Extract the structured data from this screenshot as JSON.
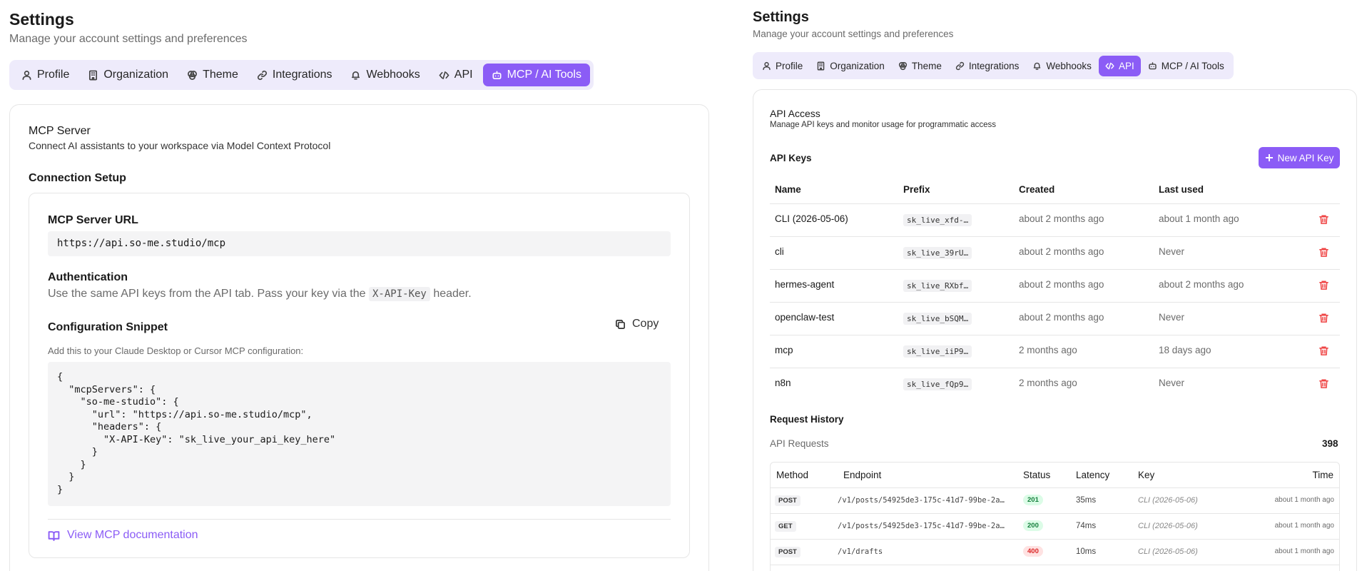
{
  "left": {
    "title": "Settings",
    "subtitle": "Manage your account settings and preferences",
    "tabs": [
      {
        "label": "Profile",
        "icon": "user-icon"
      },
      {
        "label": "Organization",
        "icon": "building-icon"
      },
      {
        "label": "Theme",
        "icon": "palette-icon"
      },
      {
        "label": "Integrations",
        "icon": "link-icon"
      },
      {
        "label": "Webhooks",
        "icon": "webhook-icon"
      },
      {
        "label": "API",
        "icon": "code-icon"
      },
      {
        "label": "MCP / AI Tools",
        "icon": "bot-icon",
        "active": true
      }
    ],
    "mcp": {
      "title": "MCP Server",
      "subtitle": "Connect AI assistants to your workspace via Model Context Protocol",
      "setup_title": "Connection Setup",
      "url_label": "MCP Server URL",
      "url_value": "https://api.so-me.studio/mcp",
      "auth_label": "Authentication",
      "auth_text_before": "Use the same API keys from the API tab. Pass your key via the",
      "auth_code": "X-API-Key",
      "auth_text_after": "header.",
      "snippet_label": "Configuration Snippet",
      "copy_label": "Copy",
      "snippet_hint": "Add this to your Claude Desktop or Cursor MCP configuration:",
      "snippet_code": "{\n  \"mcpServers\": {\n    \"so-me-studio\": {\n      \"url\": \"https://api.so-me.studio/mcp\",\n      \"headers\": {\n        \"X-API-Key\": \"sk_live_your_api_key_here\"\n      }\n    }\n  }\n}",
      "doc_link": "View MCP documentation"
    }
  },
  "right": {
    "title": "Settings",
    "subtitle": "Manage your account settings and preferences",
    "tabs": [
      {
        "label": "Profile",
        "icon": "user-icon"
      },
      {
        "label": "Organization",
        "icon": "building-icon"
      },
      {
        "label": "Theme",
        "icon": "palette-icon"
      },
      {
        "label": "Integrations",
        "icon": "link-icon"
      },
      {
        "label": "Webhooks",
        "icon": "webhook-icon"
      },
      {
        "label": "API",
        "icon": "code-icon",
        "active": true
      },
      {
        "label": "MCP / AI Tools",
        "icon": "bot-icon"
      }
    ],
    "api": {
      "title": "API Access",
      "subtitle": "Manage API keys and monitor usage for programmatic access",
      "keys_title": "API Keys",
      "new_key_label": "New API Key",
      "columns": [
        "Name",
        "Prefix",
        "Created",
        "Last used"
      ],
      "keys": [
        {
          "name": "CLI (2026-05-06)",
          "prefix": "sk_live_xfd-…",
          "created": "about 2 months ago",
          "last_used": "about 1 month ago"
        },
        {
          "name": "cli",
          "prefix": "sk_live_39rU…",
          "created": "about 2 months ago",
          "last_used": "Never"
        },
        {
          "name": "hermes-agent",
          "prefix": "sk_live_RXbf…",
          "created": "about 2 months ago",
          "last_used": "about 2 months ago"
        },
        {
          "name": "openclaw-test",
          "prefix": "sk_live_bSQM…",
          "created": "about 2 months ago",
          "last_used": "Never"
        },
        {
          "name": "mcp",
          "prefix": "sk_live_iiP9…",
          "created": "2 months ago",
          "last_used": "18 days ago"
        },
        {
          "name": "n8n",
          "prefix": "sk_live_fQp9…",
          "created": "2 months ago",
          "last_used": "Never"
        }
      ],
      "history_title": "Request History",
      "requests_label": "API Requests",
      "requests_count": "398",
      "req_columns": [
        "Method",
        "Endpoint",
        "Status",
        "Latency",
        "Key",
        "Time"
      ],
      "requests": [
        {
          "method": "POST",
          "endpoint": "/v1/posts/54925de3-175c-41d7-99be-2a…",
          "status": "201",
          "ok": true,
          "latency": "35ms",
          "key": "CLI (2026-05-06)",
          "time": "about 1 month ago"
        },
        {
          "method": "GET",
          "endpoint": "/v1/posts/54925de3-175c-41d7-99be-2a…",
          "status": "200",
          "ok": true,
          "latency": "74ms",
          "key": "CLI (2026-05-06)",
          "time": "about 1 month ago"
        },
        {
          "method": "POST",
          "endpoint": "/v1/drafts",
          "status": "400",
          "ok": false,
          "latency": "10ms",
          "key": "CLI (2026-05-06)",
          "time": "about 1 month ago"
        }
      ]
    }
  },
  "colors": {
    "accent": "#8b5cf6",
    "tab_bg": "#eeebfb",
    "danger": "#ef4444"
  }
}
